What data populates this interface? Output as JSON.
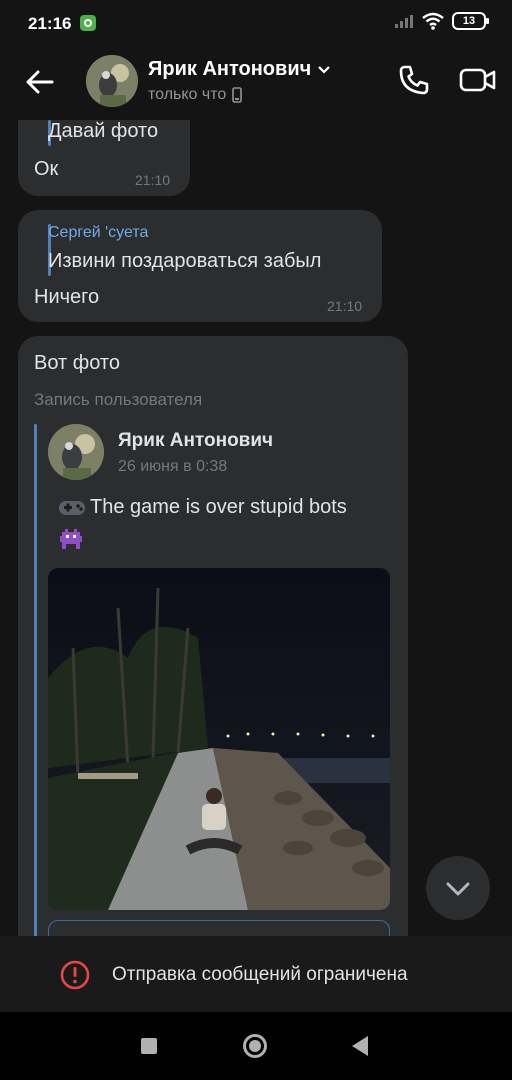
{
  "status_bar": {
    "time": "21:16",
    "battery": "13"
  },
  "header": {
    "contact_name": "Ярик Антонович",
    "contact_status": "только что"
  },
  "messages": [
    {
      "quote_text": "Давай фото",
      "text": "Ок",
      "time": "21:10"
    },
    {
      "quote_author": "Сергей 'суета",
      "quote_text": "Извини поздароваться забыл",
      "text": "Ничего",
      "time": "21:10"
    },
    {
      "text": "Вот фото",
      "subtitle": "Запись пользователя",
      "post": {
        "author": "Ярик Антонович",
        "date": "26 июня в 0:38",
        "text": "The game is over stupid bots"
      }
    }
  ],
  "restriction_notice": "Отправка сообщений ограничена",
  "colors": {
    "accent": "#71aaeb",
    "bubble": "#2c2d2e",
    "background": "#141414",
    "warning": "#e64646"
  }
}
